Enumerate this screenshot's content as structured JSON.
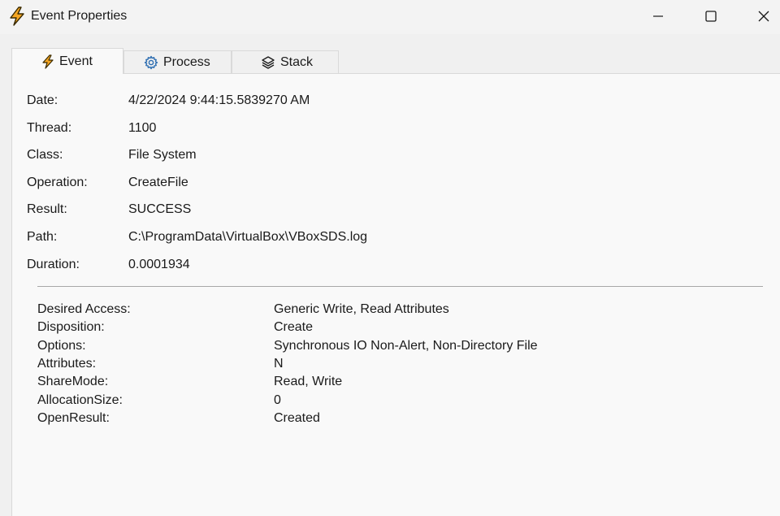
{
  "window": {
    "title": "Event Properties",
    "icon": "lightning-icon",
    "controls": {
      "minimize": "minimize-icon",
      "maximize": "maximize-icon",
      "close": "close-icon"
    }
  },
  "tabs": [
    {
      "label": "Event",
      "icon": "lightning-icon",
      "active": true
    },
    {
      "label": "Process",
      "icon": "gear-icon",
      "active": false
    },
    {
      "label": "Stack",
      "icon": "layers-icon",
      "active": false
    }
  ],
  "properties": [
    {
      "label": "Date:",
      "value": "4/22/2024 9:44:15.5839270 AM"
    },
    {
      "label": "Thread:",
      "value": "1100"
    },
    {
      "label": "Class:",
      "value": "File System"
    },
    {
      "label": "Operation:",
      "value": "CreateFile"
    },
    {
      "label": "Result:",
      "value": "SUCCESS"
    },
    {
      "label": "Path:",
      "value": "C:\\ProgramData\\VirtualBox\\VBoxSDS.log"
    },
    {
      "label": "Duration:",
      "value": "0.0001934"
    }
  ],
  "details": [
    {
      "label": "Desired Access:",
      "value": "Generic Write, Read Attributes"
    },
    {
      "label": "Disposition:",
      "value": "Create"
    },
    {
      "label": "Options:",
      "value": "Synchronous IO Non-Alert, Non-Directory File"
    },
    {
      "label": "Attributes:",
      "value": "N"
    },
    {
      "label": "ShareMode:",
      "value": "Read, Write"
    },
    {
      "label": "AllocationSize:",
      "value": "0"
    },
    {
      "label": "OpenResult:",
      "value": "Created"
    }
  ],
  "colors": {
    "lightning": "#f5a623",
    "lightning_stroke": "#3a2a00",
    "gear": "#2b6cb0"
  }
}
